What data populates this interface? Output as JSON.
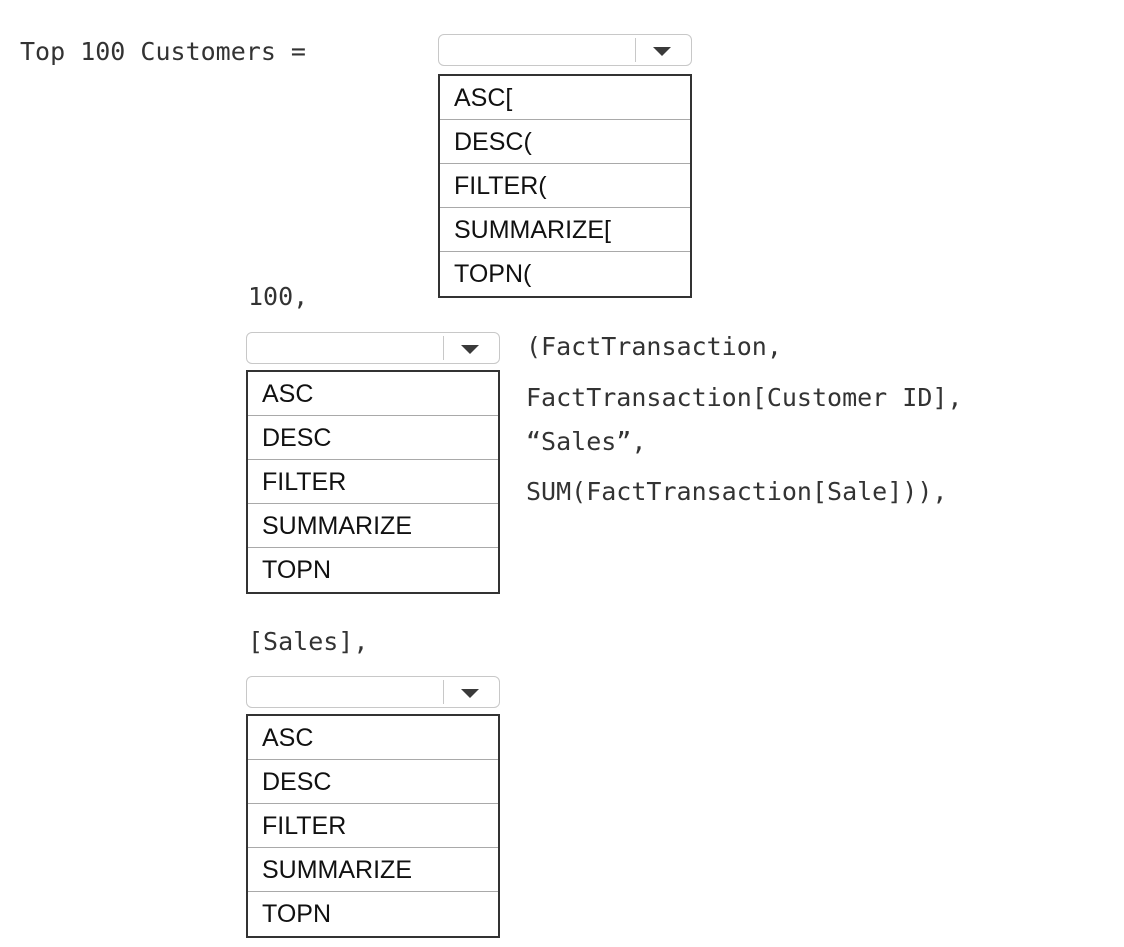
{
  "code": {
    "line_top": "Top 100 Customers =",
    "line_n": "100,",
    "line_args_1": "(FactTransaction,",
    "line_args_2": "FactTransaction[Customer ID],",
    "line_args_3": "“Sales”,",
    "line_args_4": "SUM(FactTransaction[Sale])),",
    "line_sales": "[Sales],"
  },
  "dropdown1": {
    "selected": "",
    "options": [
      "ASC[",
      "DESC(",
      "FILTER(",
      "SUMMARIZE[",
      "TOPN("
    ]
  },
  "dropdown2": {
    "selected": "",
    "options": [
      "ASC",
      "DESC",
      "FILTER",
      "SUMMARIZE",
      "TOPN"
    ]
  },
  "dropdown3": {
    "selected": "",
    "options": [
      "ASC",
      "DESC",
      "FILTER",
      "SUMMARIZE",
      "TOPN"
    ]
  },
  "icons": {
    "dropdown_arrow": "chevron-down-icon"
  }
}
